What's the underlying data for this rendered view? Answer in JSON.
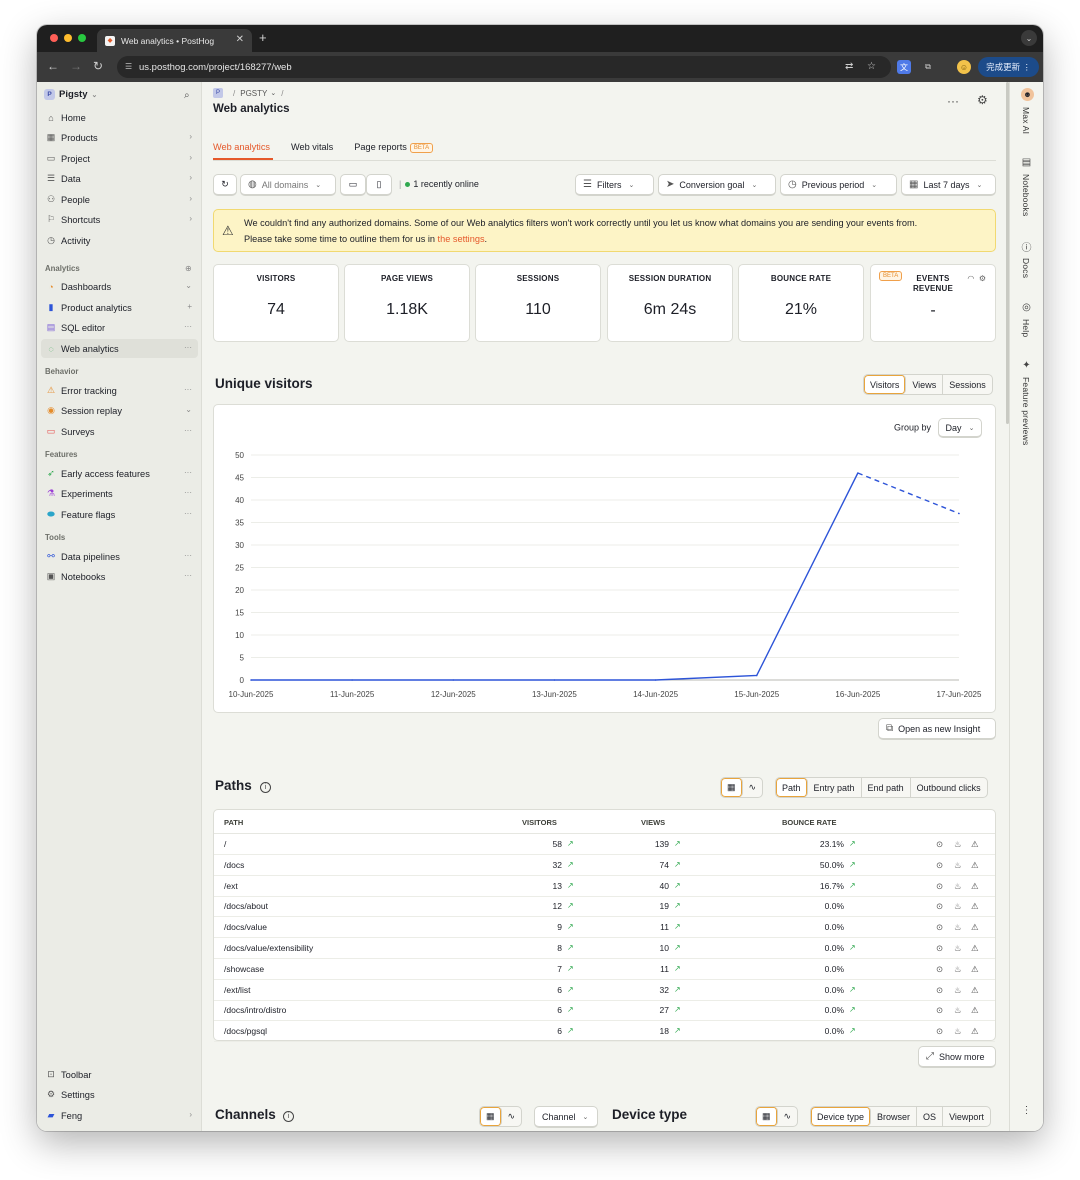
{
  "browser": {
    "tab_title": "Web analytics • PostHog",
    "url": "us.posthog.com/project/168277/web",
    "update_label": "完成更新"
  },
  "sidebar": {
    "project_name": "Pigsty",
    "project_initial": "P",
    "top_items": [
      {
        "label": "Home",
        "icon": "home-icon"
      },
      {
        "label": "Products",
        "icon": "products-icon"
      },
      {
        "label": "Project",
        "icon": "folder-icon"
      },
      {
        "label": "Data",
        "icon": "database-icon"
      },
      {
        "label": "People",
        "icon": "people-icon"
      },
      {
        "label": "Shortcuts",
        "icon": "shortcut-icon"
      },
      {
        "label": "Activity",
        "icon": "clock-icon"
      }
    ],
    "sections": {
      "analytics": "Analytics",
      "behavior": "Behavior",
      "features": "Features",
      "tools": "Tools"
    },
    "analytics_items": [
      {
        "label": "Dashboards"
      },
      {
        "label": "Product analytics"
      },
      {
        "label": "SQL editor"
      },
      {
        "label": "Web analytics"
      }
    ],
    "behavior_items": [
      {
        "label": "Error tracking"
      },
      {
        "label": "Session replay"
      },
      {
        "label": "Surveys"
      }
    ],
    "features_items": [
      {
        "label": "Early access features"
      },
      {
        "label": "Experiments"
      },
      {
        "label": "Feature flags"
      }
    ],
    "tools_items": [
      {
        "label": "Data pipelines"
      },
      {
        "label": "Notebooks"
      }
    ],
    "bottom_items": [
      {
        "label": "Toolbar"
      },
      {
        "label": "Settings"
      },
      {
        "label": "Feng"
      }
    ]
  },
  "header": {
    "breadcrumb": "PGSTY",
    "title": "Web analytics"
  },
  "tabs": [
    {
      "label": "Web analytics",
      "active": true
    },
    {
      "label": "Web vitals",
      "active": false
    },
    {
      "label": "Page reports",
      "active": false,
      "badge": "BETA"
    }
  ],
  "filters": {
    "domains": "All domains",
    "online": "1 recently online",
    "filters": "Filters",
    "conversion": "Conversion goal",
    "compare": "Previous period",
    "range": "Last 7 days"
  },
  "warning": {
    "line1": "We couldn't find any authorized domains. Some of our Web analytics filters won't work correctly until you let us know what domains you are sending your events from.",
    "line2_prefix": "Please take some time to outline them for us in ",
    "link": "the settings",
    "line2_suffix": "."
  },
  "stats": [
    {
      "label": "VISITORS",
      "value": "74"
    },
    {
      "label": "PAGE VIEWS",
      "value": "1.18K"
    },
    {
      "label": "SESSIONS",
      "value": "110"
    },
    {
      "label": "SESSION DURATION",
      "value": "6m 24s"
    },
    {
      "label": "BOUNCE RATE",
      "value": "21%"
    },
    {
      "label_line1": "EVENTS",
      "label_line2": "REVENUE",
      "value": "-",
      "badge": "BETA"
    }
  ],
  "unique_visitors": {
    "title": "Unique visitors",
    "toggle": [
      "Visitors",
      "Views",
      "Sessions"
    ],
    "group_by_label": "Group by",
    "group_by_value": "Day",
    "open_insight": "Open as new Insight"
  },
  "chart_data": {
    "type": "line",
    "x": [
      "10-Jun-2025",
      "11-Jun-2025",
      "12-Jun-2025",
      "13-Jun-2025",
      "14-Jun-2025",
      "15-Jun-2025",
      "16-Jun-2025",
      "17-Jun-2025"
    ],
    "series": [
      {
        "values": [
          0,
          0,
          0,
          0,
          0,
          1,
          46,
          37
        ],
        "color": "#2d54d8",
        "incomplete_last_segment": true
      }
    ],
    "y_ticks": [
      0,
      5,
      10,
      15,
      20,
      25,
      30,
      35,
      40,
      45,
      50
    ],
    "ylim": [
      0,
      50
    ],
    "grid": true
  },
  "paths": {
    "title": "Paths",
    "toggle": [
      "Path",
      "Entry path",
      "End path",
      "Outbound clicks"
    ],
    "columns": [
      "PATH",
      "VISITORS",
      "VIEWS",
      "BOUNCE RATE"
    ],
    "rows": [
      {
        "path": "/",
        "visitors": "58",
        "views": "139",
        "bounce": "23.1%",
        "bounce_trend": true
      },
      {
        "path": "/docs",
        "visitors": "32",
        "views": "74",
        "bounce": "50.0%",
        "bounce_trend": true
      },
      {
        "path": "/ext",
        "visitors": "13",
        "views": "40",
        "bounce": "16.7%",
        "bounce_trend": true
      },
      {
        "path": "/docs/about",
        "visitors": "12",
        "views": "19",
        "bounce": "0.0%",
        "bounce_trend": false
      },
      {
        "path": "/docs/value",
        "visitors": "9",
        "views": "11",
        "bounce": "0.0%",
        "bounce_trend": false
      },
      {
        "path": "/docs/value/extensibility",
        "visitors": "8",
        "views": "10",
        "bounce": "0.0%",
        "bounce_trend": true
      },
      {
        "path": "/showcase",
        "visitors": "7",
        "views": "11",
        "bounce": "0.0%",
        "bounce_trend": false
      },
      {
        "path": "/ext/list",
        "visitors": "6",
        "views": "32",
        "bounce": "0.0%",
        "bounce_trend": true
      },
      {
        "path": "/docs/intro/distro",
        "visitors": "6",
        "views": "27",
        "bounce": "0.0%",
        "bounce_trend": true
      },
      {
        "path": "/docs/pgsql",
        "visitors": "6",
        "views": "18",
        "bounce": "0.0%",
        "bounce_trend": true
      }
    ],
    "show_more": "Show more"
  },
  "channels": {
    "title": "Channels",
    "select": "Channel"
  },
  "device_type": {
    "title": "Device type",
    "toggle": [
      "Device type",
      "Browser",
      "OS",
      "Viewport"
    ]
  },
  "rightbar": {
    "items": [
      "Max AI",
      "Notebooks",
      "Docs",
      "Help",
      "Feature previews"
    ]
  }
}
